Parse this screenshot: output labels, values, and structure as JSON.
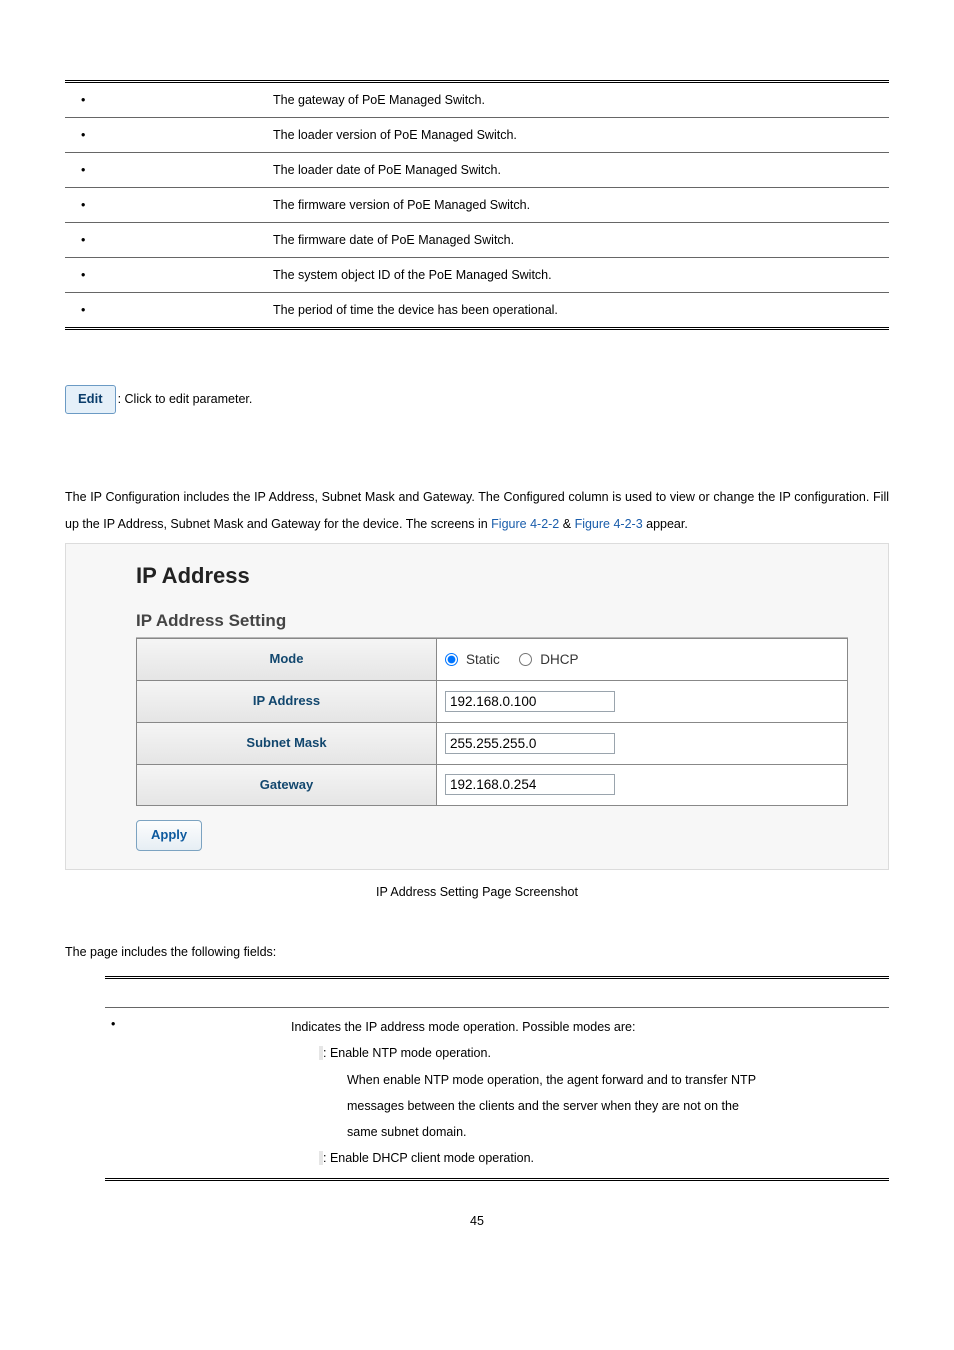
{
  "table1": {
    "rows": [
      "The gateway of PoE Managed Switch.",
      "The loader version of PoE Managed Switch.",
      "The loader date of PoE Managed Switch.",
      "The firmware version of PoE Managed Switch.",
      "The firmware date of PoE Managed Switch.",
      "The system object ID of the PoE Managed Switch.",
      "The period of time the device has been operational."
    ]
  },
  "editBtn": {
    "label": "Edit",
    "desc": ": Click to edit parameter."
  },
  "paragraph": {
    "pre": "The IP Configuration includes the IP Address, Subnet Mask and Gateway. The Configured column is used to view or change the IP configuration. Fill up the IP Address, Subnet Mask and Gateway for the device. The screens in ",
    "link1": "Figure 4-2-2",
    "mid": " & ",
    "link2": "Figure 4-2-3",
    "post": " appear."
  },
  "screenshot": {
    "title": "IP Address",
    "subtitle": "IP Address Setting",
    "rows": {
      "mode": {
        "label": "Mode",
        "opt1": "Static",
        "opt2": "DHCP"
      },
      "ip": {
        "label": "IP Address",
        "value": "192.168.0.100"
      },
      "mask": {
        "label": "Subnet Mask",
        "value": "255.255.255.0"
      },
      "gw": {
        "label": "Gateway",
        "value": "192.168.0.254"
      }
    },
    "apply": "Apply"
  },
  "caption": "IP Address Setting Page Screenshot",
  "fieldsIntro": "The page includes the following fields:",
  "fieldsTable": {
    "row1": {
      "desc0": "Indicates the IP address mode operation. Possible modes are:",
      "staticLabel": "",
      "staticAfter": ": Enable NTP mode operation.",
      "staticLine2": "When enable NTP mode operation, the agent forward and to transfer NTP",
      "staticLine3": "messages between the clients and the server when they are not on the",
      "staticLine4": "same subnet domain.",
      "dhcpLabel": "",
      "dhcpAfter": ": Enable DHCP client mode operation."
    }
  },
  "pageNumber": "45"
}
